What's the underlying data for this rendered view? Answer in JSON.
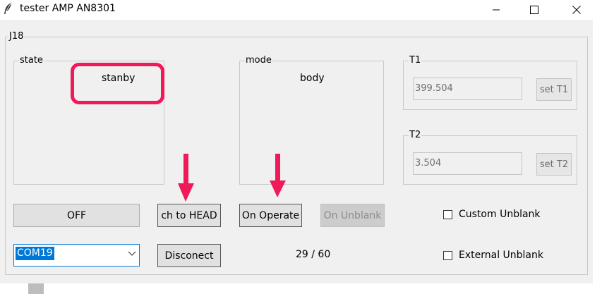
{
  "window": {
    "title": "tester AMP AN8301",
    "icon": "feather-icon",
    "controls": [
      "minimize-icon",
      "maximize-icon",
      "close-icon"
    ]
  },
  "frame": {
    "label": "J18"
  },
  "state": {
    "label": "state",
    "value": "stanby"
  },
  "mode": {
    "label": "mode",
    "value": "body"
  },
  "t1": {
    "label": "T1",
    "value": "399.504",
    "button": "set T1"
  },
  "t2": {
    "label": "T2",
    "value": "3.504",
    "button": "set T2"
  },
  "buttons": {
    "off": "OFF",
    "head": "ch to HEAD",
    "operate": "On Operate",
    "unblank": "On Unblank",
    "disconnect": "Disconect"
  },
  "port": {
    "selected": "COM19"
  },
  "counter": "29 / 60",
  "checkboxes": {
    "custom_unblank": "Custom Unblank",
    "external_unblank": "External Unblank"
  },
  "annotation": {
    "color": "#f0195a"
  }
}
